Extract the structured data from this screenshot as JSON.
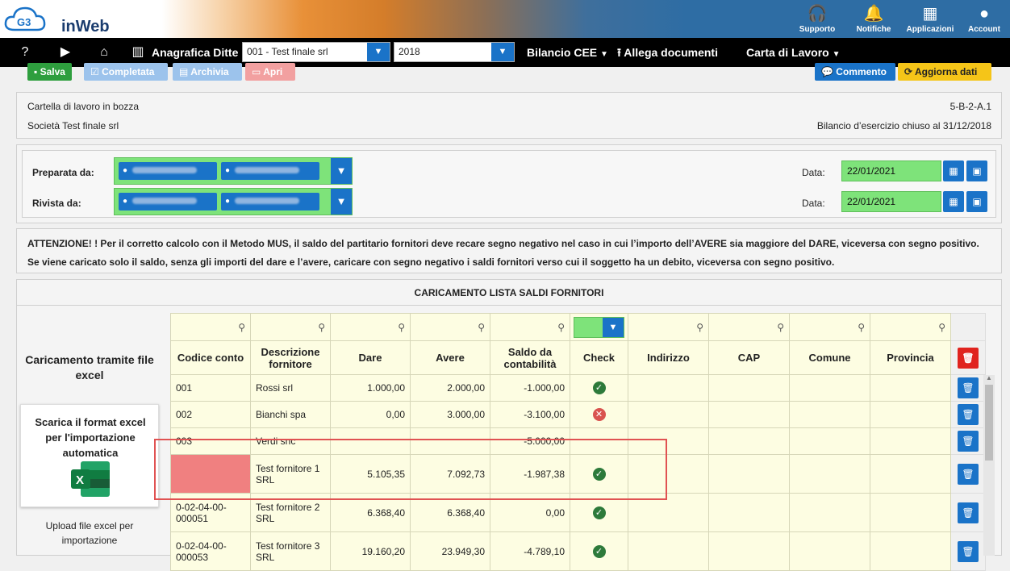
{
  "app": {
    "logo_mark": "G3",
    "logo_text": "inWeb"
  },
  "topbar": {
    "items": [
      {
        "label": "Supporto",
        "icon": "headset-icon",
        "glyph": "🎧"
      },
      {
        "label": "Notifiche",
        "icon": "bell-icon",
        "glyph": "🔔"
      },
      {
        "label": "Applicazioni",
        "icon": "grid-icon",
        "glyph": "▦"
      },
      {
        "label": "Account",
        "icon": "account-icon",
        "glyph": "●"
      }
    ]
  },
  "menubar": {
    "help": "?",
    "anagrafica": "Anagrafica Ditte",
    "company_select": "001 - Test finale srl",
    "year_select": "2018",
    "bilancio": "Bilancio CEE",
    "allega": "Allega documenti",
    "carta": "Carta di Lavoro"
  },
  "toolbar": {
    "salva": "Salva",
    "completata": "Completata",
    "archivia": "Archivia",
    "apri": "Apri",
    "commento": "Commento",
    "aggiorna": "Aggiorna dati"
  },
  "info": {
    "status": "Cartella di lavoro in bozza",
    "code": "5-B-2-A.1",
    "company": "Società Test finale srl",
    "bilancio": "Bilancio d’esercizio chiuso al 31/12/2018"
  },
  "review": {
    "preparata_label": "Preparata da:",
    "rivista_label": "Rivista da:",
    "data_label": "Data:",
    "data_preparata": "22/01/2021",
    "data_rivista": "22/01/2021"
  },
  "warning": {
    "line1": "ATTENZIONE! ! Per il corretto calcolo con il Metodo MUS, il saldo del partitario fornitori deve recare segno negativo nel caso in cui l’importo dell’AVERE sia maggiore del DARE, viceversa con segno positivo.",
    "line2": "Se viene caricato solo il saldo, senza gli importi del dare e l’avere, caricare con segno negativo i saldi fornitori verso cui il soggetto ha un debito, viceversa con segno positivo."
  },
  "section": {
    "title": "CARICAMENTO LISTA SALDI FORNITORI"
  },
  "sidebar": {
    "excel_title": "Caricamento tramite file excel",
    "download": "Scarica il format excel per l'importazione automatica",
    "upload": "Upload file excel per importazione"
  },
  "table": {
    "headers": [
      "Codice conto",
      "Descrizione fornitore",
      "Dare",
      "Avere",
      "Saldo da contabilità",
      "Check",
      "Indirizzo",
      "CAP",
      "Comune",
      "Provincia"
    ],
    "rows": [
      {
        "codice": "001",
        "descr": "Rossi srl",
        "dare": "1.000,00",
        "avere": "2.000,00",
        "saldo": "-1.000,00",
        "check": "ok"
      },
      {
        "codice": "002",
        "descr": "Bianchi spa",
        "dare": "0,00",
        "avere": "3.000,00",
        "saldo": "-3.100,00",
        "check": "ko"
      },
      {
        "codice": "003",
        "descr": "Verdi snc",
        "dare": "",
        "avere": "",
        "saldo": "-5.000,00",
        "check": ""
      },
      {
        "codice": "",
        "descr": "Test fornitore 1 SRL",
        "dare": "5.105,35",
        "avere": "7.092,73",
        "saldo": "-1.987,38",
        "check": "ok"
      },
      {
        "codice": "0-02-04-00-000051",
        "descr": "Test fornitore 2 SRL",
        "dare": "6.368,40",
        "avere": "6.368,40",
        "saldo": "0,00",
        "check": "ok"
      },
      {
        "codice": "0-02-04-00-000053",
        "descr": "Test fornitore 3 SRL",
        "dare": "19.160,20",
        "avere": "23.949,30",
        "saldo": "-4.789,10",
        "check": "ok"
      }
    ]
  },
  "colors": {
    "accent": "#1a73c8",
    "green": "#7ee37a",
    "highlight": "#f08080",
    "salva": "#2e9e3e",
    "pale_blue": "#9cc3ec",
    "pale_red": "#f2a0a0",
    "aggiorna": "#f5c518"
  }
}
